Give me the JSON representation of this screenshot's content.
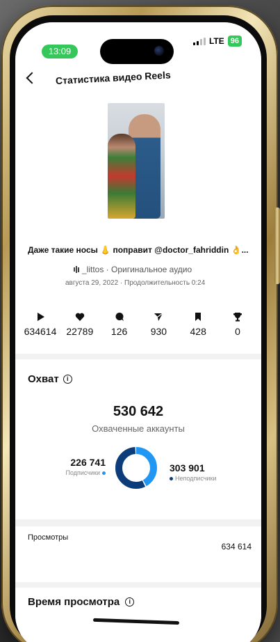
{
  "status_bar": {
    "time": "13:09",
    "network": "LTE",
    "battery": "96"
  },
  "nav": {
    "title": "Статистика видео Reels",
    "back_icon": "chevron-left-icon"
  },
  "post": {
    "caption": "Даже такие носы 👃 поправит @doctor_fahriddin 👌...",
    "audio": "_littos · Оригинальное аудио",
    "meta": "августа 29, 2022 · Продолжительность 0:24",
    "stats": [
      {
        "icon": "play-icon",
        "value": "634614"
      },
      {
        "icon": "heart-icon",
        "value": "22789"
      },
      {
        "icon": "comment-icon",
        "value": "126"
      },
      {
        "icon": "share-icon",
        "value": "930"
      },
      {
        "icon": "bookmark-icon",
        "value": "428"
      },
      {
        "icon": "trophy-icon",
        "value": "0"
      }
    ]
  },
  "reach": {
    "title": "Охват",
    "total": "530 642",
    "total_label": "Охваченные аккаунты",
    "followers": {
      "value": "226 741",
      "label": "Подписчики",
      "color": "#2196f3"
    },
    "non_followers": {
      "value": "303 901",
      "label": "Неподписчики",
      "color": "#0d3c7a"
    }
  },
  "chart_data": {
    "type": "pie",
    "categories": [
      "Подписчики",
      "Неподписчики"
    ],
    "values": [
      226741,
      303901
    ],
    "colors": [
      "#2196f3",
      "#0d3c7a"
    ]
  },
  "views": {
    "label": "Просмотры",
    "value": "634 614"
  },
  "watch_time": {
    "title": "Время просмотра"
  },
  "colors": {
    "accent_green": "#35c759",
    "followers_blue": "#2196f3",
    "non_followers_navy": "#0d3c7a"
  }
}
